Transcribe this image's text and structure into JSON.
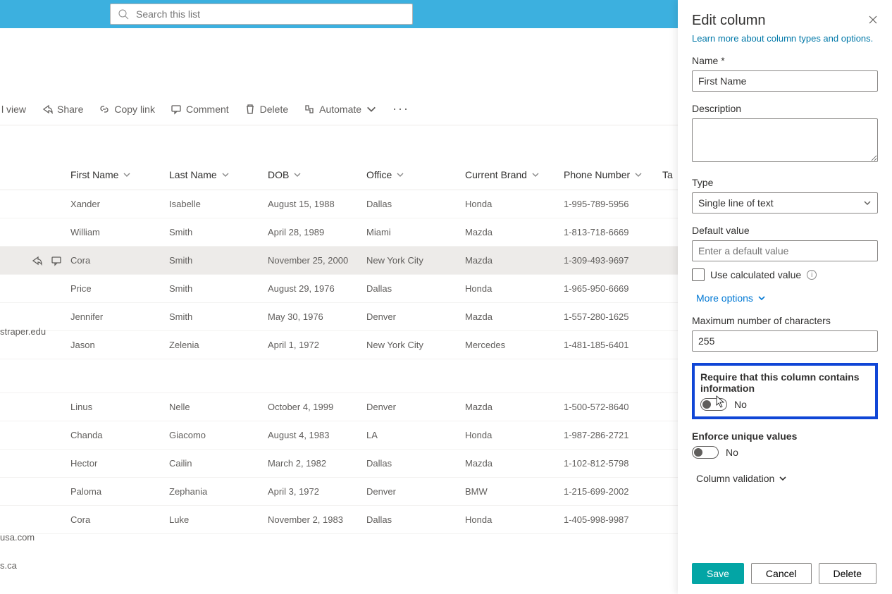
{
  "search": {
    "placeholder": "Search this list"
  },
  "commands": {
    "view": "l view",
    "share": "Share",
    "copylink": "Copy link",
    "comment": "Comment",
    "delete": "Delete",
    "automate": "Automate"
  },
  "columns": {
    "firstname": "First Name",
    "lastname": "Last Name",
    "dob": "DOB",
    "office": "Office",
    "brand": "Current Brand",
    "phone": "Phone Number",
    "tags": "Ta"
  },
  "rows": [
    {
      "first": "Xander",
      "last": "Isabelle",
      "dob": "August 15, 1988",
      "office": "Dallas",
      "brand": "Honda",
      "phone": "1-995-789-5956",
      "selected": false
    },
    {
      "first": "William",
      "last": "Smith",
      "dob": "April 28, 1989",
      "office": "Miami",
      "brand": "Mazda",
      "phone": "1-813-718-6669",
      "selected": false
    },
    {
      "first": "Cora",
      "last": "Smith",
      "dob": "November 25, 2000",
      "office": "New York City",
      "brand": "Mazda",
      "phone": "1-309-493-9697",
      "selected": true
    },
    {
      "first": "Price",
      "last": "Smith",
      "dob": "August 29, 1976",
      "office": "Dallas",
      "brand": "Honda",
      "phone": "1-965-950-6669",
      "selected": false
    },
    {
      "first": "Jennifer",
      "last": "Smith",
      "dob": "May 30, 1976",
      "office": "Denver",
      "brand": "Mazda",
      "phone": "1-557-280-1625",
      "selected": false
    },
    {
      "first": "Jason",
      "last": "Zelenia",
      "dob": "April 1, 1972",
      "office": "New York City",
      "brand": "Mercedes",
      "phone": "1-481-185-6401",
      "selected": false
    }
  ],
  "rows2": [
    {
      "first": "Linus",
      "last": "Nelle",
      "dob": "October 4, 1999",
      "office": "Denver",
      "brand": "Mazda",
      "phone": "1-500-572-8640"
    },
    {
      "first": "Chanda",
      "last": "Giacomo",
      "dob": "August 4, 1983",
      "office": "LA",
      "brand": "Honda",
      "phone": "1-987-286-2721"
    },
    {
      "first": "Hector",
      "last": "Cailin",
      "dob": "March 2, 1982",
      "office": "Dallas",
      "brand": "Mazda",
      "phone": "1-102-812-5798"
    },
    {
      "first": "Paloma",
      "last": "Zephania",
      "dob": "April 3, 1972",
      "office": "Denver",
      "brand": "BMW",
      "phone": "1-215-699-2002"
    },
    {
      "first": "Cora",
      "last": "Luke",
      "dob": "November 2, 1983",
      "office": "Dallas",
      "brand": "Honda",
      "phone": "1-405-998-9987"
    }
  ],
  "leftfrags": {
    "f1": "straper.edu",
    "f2": "usa.com",
    "f3": "s.ca"
  },
  "panel": {
    "title": "Edit column",
    "learn": "Learn more about column types and options.",
    "name_label": "Name *",
    "name_value": "First Name",
    "desc_label": "Description",
    "type_label": "Type",
    "type_value": "Single line of text",
    "default_label": "Default value",
    "default_placeholder": "Enter a default value",
    "calc_label": "Use calculated value",
    "more_options": "More options",
    "max_label": "Maximum number of characters",
    "max_value": "255",
    "require_label": "Require that this column contains information",
    "require_state": "No",
    "unique_label": "Enforce unique values",
    "unique_state": "No",
    "validation": "Column validation",
    "save": "Save",
    "cancel": "Cancel",
    "delete": "Delete"
  }
}
